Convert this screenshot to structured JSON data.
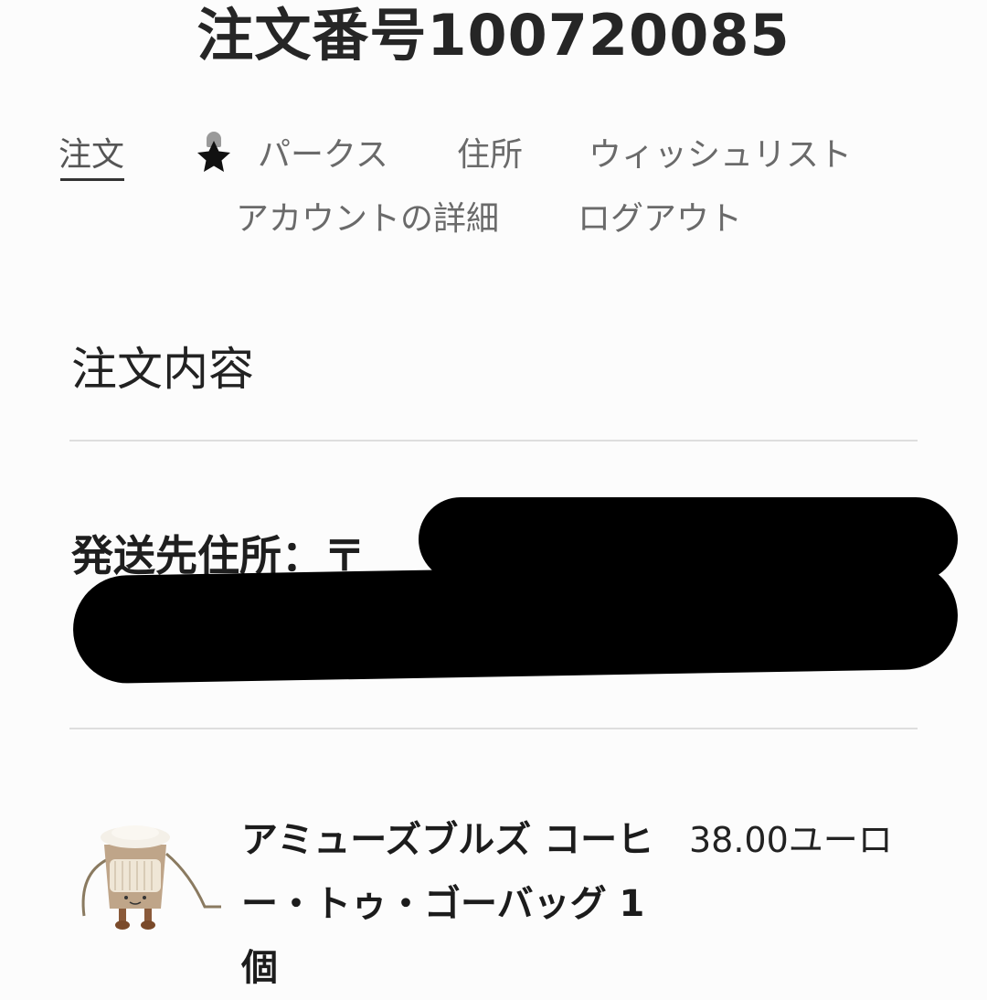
{
  "order": {
    "title": "注文番号100720085"
  },
  "nav": {
    "items": [
      {
        "label": "注文",
        "active": true
      },
      {
        "label": "パークス",
        "icon": "star-person-icon"
      },
      {
        "label": "住所"
      },
      {
        "label": "ウィッシュリスト"
      },
      {
        "label": "アカウントの詳細"
      },
      {
        "label": "ログアウト"
      }
    ]
  },
  "order_details": {
    "heading": "注文内容",
    "shipping_label": "発送先住所：〒"
  },
  "line_item": {
    "name": "アミューズブルズ コーヒー・トゥ・ゴーバッグ",
    "quantity": "1個",
    "price": "38.00ユーロ"
  }
}
